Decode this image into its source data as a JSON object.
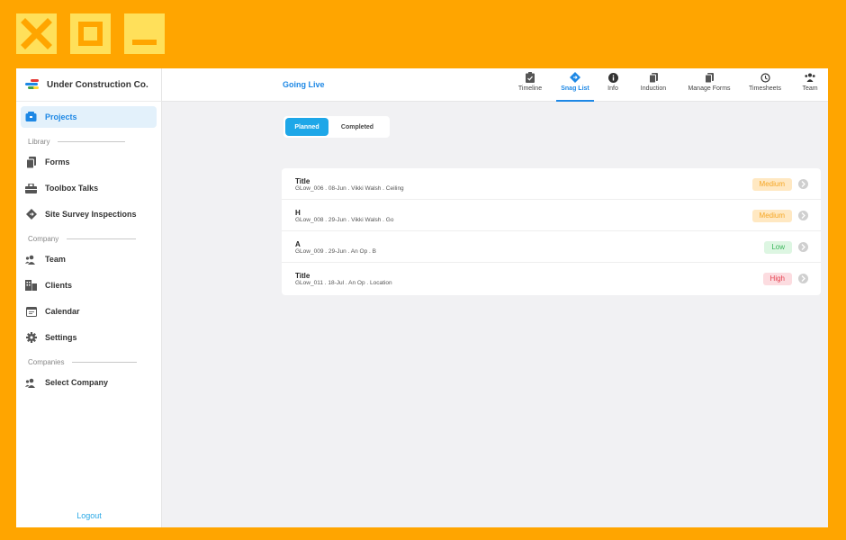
{
  "colors": {
    "frame": "#FFA500",
    "chrome_button": "#FFE05A",
    "accent": "#1E88E5"
  },
  "window_controls": [
    {
      "name": "close-icon"
    },
    {
      "name": "maximize-icon"
    },
    {
      "name": "minimize-icon"
    }
  ],
  "brand": {
    "name": "Under Construction Co."
  },
  "sidebar": {
    "projects_label": "Projects",
    "library_section": "Library",
    "forms_label": "Forms",
    "toolbox_label": "Toolbox Talks",
    "survey_label": "Site Survey Inspections",
    "company_section": "Company",
    "team_label": "Team",
    "clients_label": "Clients",
    "calendar_label": "Calendar",
    "settings_label": "Settings",
    "companies_section": "Companies",
    "select_company_label": "Select Company",
    "logout_label": "Logout"
  },
  "header": {
    "title": "Going Live"
  },
  "tabs": {
    "timeline": "Timeline",
    "snag_list": "Snag List",
    "info": "Info",
    "induction": "Induction",
    "manage_forms": "Manage Forms",
    "timesheets": "Timesheets",
    "team": "Team"
  },
  "segments": {
    "planned": "Planned",
    "completed": "Completed"
  },
  "snags": [
    {
      "title": "Title",
      "meta": "GLow_006 .  08-Jun .  Vikki Walsh .  Ceiling",
      "priority": "Medium"
    },
    {
      "title": "H",
      "meta": "GLow_008 .  29-Jun .  Vikki Walsh .  Go",
      "priority": "Medium"
    },
    {
      "title": "A",
      "meta": "GLow_009 .  29-Jun .  An Op .  B",
      "priority": "Low"
    },
    {
      "title": "Title",
      "meta": "GLow_011 .  18-Jul .  An Op .  Location",
      "priority": "High"
    }
  ]
}
